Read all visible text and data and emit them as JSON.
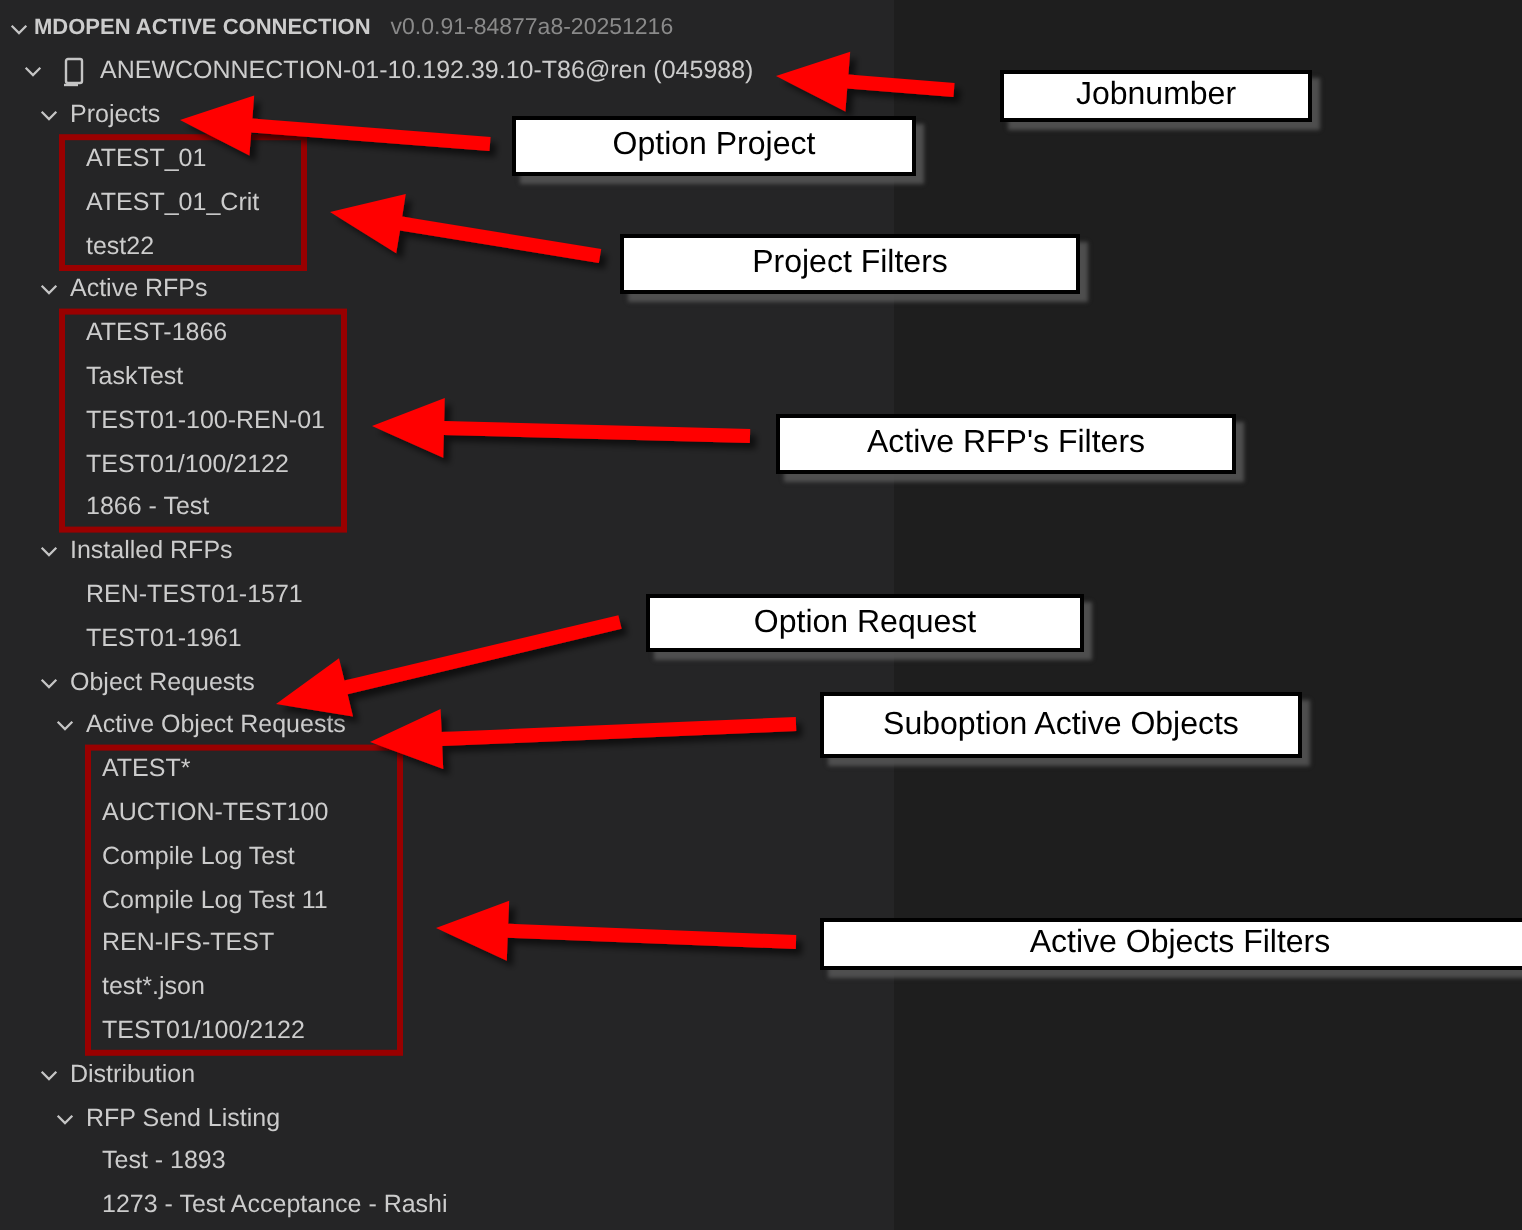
{
  "section": {
    "title": "MDOPEN ACTIVE CONNECTION",
    "version": "v0.0.91-84877a8-20251216",
    "expanded": true
  },
  "tree": [
    {
      "label": "ANEWCONNECTION-01-10.192.39.10-T86@ren (045988)",
      "kind": "connection",
      "expanded": true,
      "children": [
        {
          "label": "Projects",
          "expanded": true,
          "children": [
            {
              "label": "ATEST_01"
            },
            {
              "label": "ATEST_01_Crit"
            },
            {
              "label": "test22"
            }
          ]
        },
        {
          "label": "Active RFPs",
          "expanded": true,
          "children": [
            {
              "label": "ATEST-1866"
            },
            {
              "label": "TaskTest"
            },
            {
              "label": "TEST01-100-REN-01"
            },
            {
              "label": "TEST01/100/2122"
            },
            {
              "label": "1866 - Test"
            }
          ]
        },
        {
          "label": "Installed RFPs",
          "expanded": true,
          "children": [
            {
              "label": "REN-TEST01-1571"
            },
            {
              "label": "TEST01-1961"
            }
          ]
        },
        {
          "label": "Object Requests",
          "expanded": true,
          "children": [
            {
              "label": "Active Object Requests",
              "expanded": true,
              "children": [
                {
                  "label": "ATEST*"
                },
                {
                  "label": "AUCTION-TEST100"
                },
                {
                  "label": "Compile Log Test"
                },
                {
                  "label": "Compile Log Test 11"
                },
                {
                  "label": "REN-IFS-TEST"
                },
                {
                  "label": "test*.json"
                },
                {
                  "label": "TEST01/100/2122"
                }
              ]
            }
          ]
        },
        {
          "label": "Distribution",
          "expanded": true,
          "children": [
            {
              "label": "RFP Send Listing",
              "expanded": true,
              "children": [
                {
                  "label": "Test - 1893"
                },
                {
                  "label": "1273 - Test Acceptance - Rashi"
                }
              ]
            }
          ]
        }
      ]
    }
  ],
  "callouts": [
    {
      "text": "Jobnumber"
    },
    {
      "text": "Option Project"
    },
    {
      "text": "Project Filters"
    },
    {
      "text": "Active RFP's Filters"
    },
    {
      "text": "Option Request"
    },
    {
      "text": "Suboption Active Objects"
    },
    {
      "text": "Active Objects Filters"
    }
  ]
}
